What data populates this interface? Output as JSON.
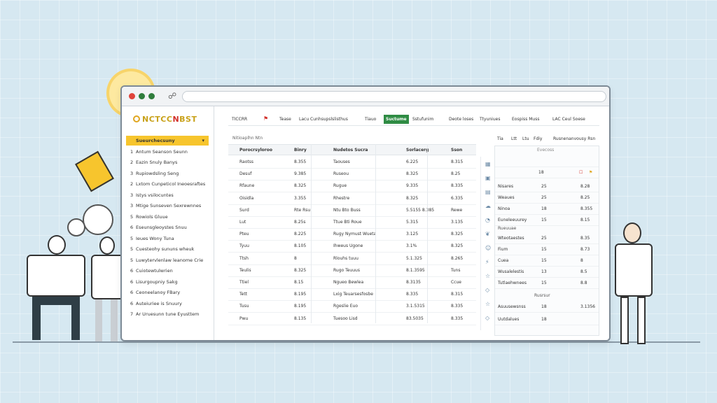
{
  "browser": {
    "nav_icon": "refresh-icon"
  },
  "sidebar": {
    "logo_prefix": "NCTCC",
    "logo_accent": "N",
    "logo_suffix": "BST",
    "items": [
      {
        "num": "",
        "label": "Sueurchecsuny",
        "chev": "▾"
      },
      {
        "num": "1",
        "label": "Antum Seanson Seunn"
      },
      {
        "num": "2",
        "label": "Eazin Snuly Banys"
      },
      {
        "num": "3",
        "label": "Rupiowdsling Seng"
      },
      {
        "num": "2",
        "label": "Lxtom Cunpeticol Ineoesraftes"
      },
      {
        "num": "3",
        "label": "Istys vsilocuntes"
      },
      {
        "num": "3",
        "label": "Mtige Sunseven Sexrewnnes"
      },
      {
        "num": "5",
        "label": "Rowiols Gluue"
      },
      {
        "num": "6",
        "label": "Eseunsgleoystes Snuu"
      },
      {
        "num": "5",
        "label": "Ieues Wony Tuna"
      },
      {
        "num": "5",
        "label": "Cuesteohy sununs wheuk"
      },
      {
        "num": "5",
        "label": "Luwytervlenlaw leanome Crie"
      },
      {
        "num": "6",
        "label": "Cuiotewtulwrien"
      },
      {
        "num": "6",
        "label": "Lisurgoupniy Sakg"
      },
      {
        "num": "6",
        "label": "Ceoneelanoy FBary"
      },
      {
        "num": "6",
        "label": "Auteiuriee is Snuury"
      },
      {
        "num": "7",
        "label": "Ar Uruesunn tune Eyusttem"
      }
    ]
  },
  "toolbar": {
    "items": [
      "TICCRR",
      "Tease",
      "Lacu Cunhsupslslisthus",
      "Tiauo",
      "Suctume",
      "Sstufunim",
      "Deote loses",
      "Ttyuniues",
      "Eospiss Muss",
      "LAC Ceul Soese"
    ],
    "active_index": 4
  },
  "table": {
    "caption": "Nitioaplhn   Ntn",
    "headers": [
      "Porocrsyloroo",
      "Binry",
      "Nudetos Sucra",
      "Sorlacerg",
      "Sson"
    ],
    "rows": [
      [
        "Raotss",
        "8.355",
        "Taouses",
        "6.225",
        "8.315"
      ],
      [
        "Desuf",
        "9.385",
        "Ruseou",
        "8.325",
        "8.25"
      ],
      [
        "Rfaune",
        "8.325",
        "Rugue",
        "9.335",
        "8.335"
      ],
      [
        "Oisidla",
        "3.355",
        "Rhestre",
        "8.325",
        "6.335"
      ],
      [
        "Surd",
        "Rte Rsu",
        "Ntu Bto Buss",
        "5.5155 8.385",
        "Rewe"
      ],
      [
        "Lut",
        "8.25s",
        "Ttue Bti Roue",
        "5.315",
        "3.135"
      ],
      [
        "Pteu",
        "8.225",
        "Rugy Nymust Wueta",
        "3.125",
        "8.325"
      ],
      [
        "Tyuu",
        "8.105",
        "Ihweus Ugone",
        "3.1%",
        "8.325"
      ],
      [
        "Ttsh",
        "8",
        "Rlouhs tuuu",
        "5.1.325",
        "8.265"
      ],
      [
        "Teulis",
        "8.325",
        "Rugo Teuuus",
        "8.1.3595",
        "Tuns"
      ],
      [
        "Ttiel",
        "8.15",
        "Ngueo Bewlea",
        "8.3135",
        "Ccue"
      ],
      [
        "Tett",
        "8.195",
        "Lxig Teuarsesfosbe",
        "8.335",
        "8.315"
      ],
      [
        "Tusu",
        "8.195",
        "Rgeslie Euo",
        "3.1.5315",
        "8.335"
      ],
      [
        "Pwu",
        "8.135",
        "Tuesoo Lisd",
        "83.5035",
        "8.335"
      ]
    ],
    "icons": [
      "calendar-icon",
      "box-icon",
      "chart-icon",
      "cloud-icon",
      "gauge-icon",
      "leaf-icon",
      "user-icon",
      "bolt-icon",
      "star-icon",
      "drop-icon",
      "star-icon",
      "drop-icon"
    ]
  },
  "right_panel": {
    "tabs": [
      "Tia",
      "Ltt",
      "Ltu",
      "Fdiy",
      "Rusnenanvousy Rsn"
    ],
    "caption": "Evecoss",
    "row1": [
      "",
      "",
      ""
    ],
    "row2": [
      "18",
      "",
      ""
    ],
    "rows": [
      [
        "Nisares",
        "25",
        "8.28"
      ],
      [
        "Weaues",
        "25",
        "8.25"
      ],
      [
        "Ninoa",
        "18",
        "8.355"
      ],
      [
        "Euneleeuurey",
        "15",
        "8.15"
      ]
    ],
    "section": "Rueuuae",
    "rows2": [
      [
        "Wteotaestes",
        "25",
        "8.35"
      ],
      [
        "Fium",
        "15",
        "8.73"
      ],
      [
        "Cuea",
        "15",
        "8"
      ],
      [
        "Wusalelestis",
        "13",
        "8.5"
      ],
      [
        "Tutlaehwnees",
        "15",
        "8.8"
      ]
    ],
    "subtotal_label": "Rusrsur",
    "rows3": [
      [
        "Asuusewsnss",
        "18",
        "3.1356"
      ],
      [
        "Uutdalues",
        "18",
        ""
      ]
    ]
  }
}
